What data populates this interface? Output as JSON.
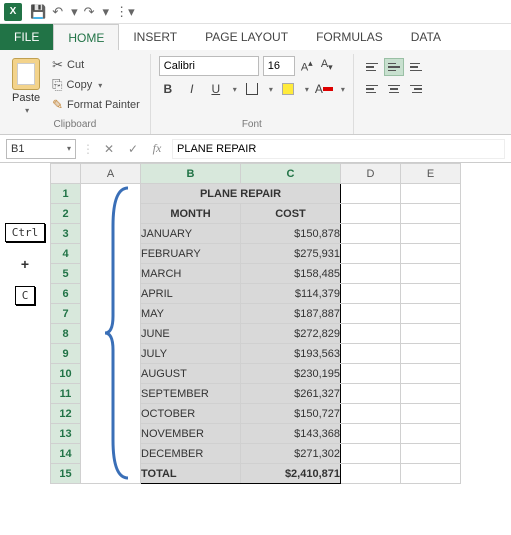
{
  "qat_icons": {
    "save": "💾",
    "undo": "↶",
    "redo": "↷",
    "customize": "▾"
  },
  "tabs": {
    "file": "FILE",
    "home": "HOME",
    "insert": "INSERT",
    "page_layout": "PAGE LAYOUT",
    "formulas": "FORMULAS",
    "data": "DATA"
  },
  "ribbon": {
    "clipboard": {
      "label": "Clipboard",
      "paste": "Paste",
      "cut": "Cut",
      "copy": "Copy",
      "format_painter": "Format Painter"
    },
    "font": {
      "label": "Font",
      "name": "Calibri",
      "size": "16",
      "increase": "A▴",
      "decrease": "A▾"
    }
  },
  "formula_bar": {
    "name_box": "B1",
    "cancel": "✕",
    "enter": "✓",
    "fx": "fx",
    "formula": "PLANE REPAIR"
  },
  "columns": [
    "A",
    "B",
    "C",
    "D",
    "E"
  ],
  "chart_data": {
    "type": "table",
    "title": "PLANE REPAIR",
    "headers": [
      "MONTH",
      "COST"
    ],
    "rows": [
      [
        "JANUARY",
        "$150,878"
      ],
      [
        "FEBRUARY",
        "$275,931"
      ],
      [
        "MARCH",
        "$158,485"
      ],
      [
        "APRIL",
        "$114,379"
      ],
      [
        "MAY",
        "$187,887"
      ],
      [
        "JUNE",
        "$272,829"
      ],
      [
        "JULY",
        "$193,563"
      ],
      [
        "AUGUST",
        "$230,195"
      ],
      [
        "SEPTEMBER",
        "$261,327"
      ],
      [
        "OCTOBER",
        "$150,727"
      ],
      [
        "NOVEMBER",
        "$143,368"
      ],
      [
        "DECEMBER",
        "$271,302"
      ]
    ],
    "total_row": [
      "TOTAL",
      "$2,410,871"
    ]
  },
  "annotation": {
    "ctrl": "Ctrl",
    "plus": "+",
    "c": "C"
  },
  "row_count": 15
}
